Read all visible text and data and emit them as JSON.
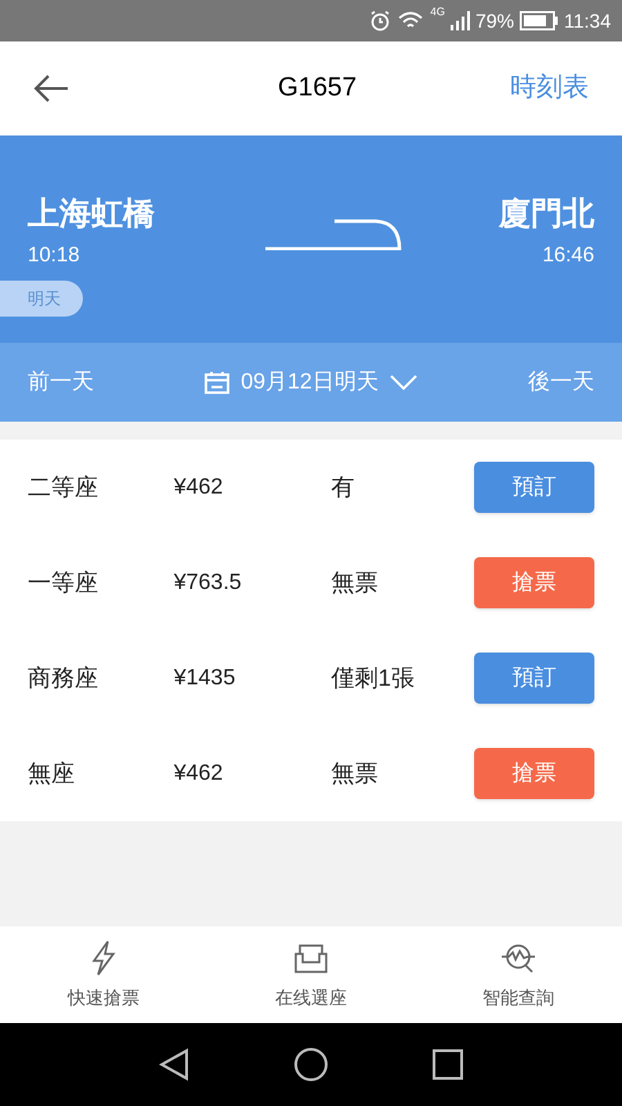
{
  "status_bar": {
    "network": "4G",
    "battery": "79%",
    "time": "11:34"
  },
  "header": {
    "title": "G1657",
    "action": "時刻表"
  },
  "train": {
    "from": "上海虹橋",
    "depart": "10:18",
    "to": "廈門北",
    "arrive": "16:46",
    "badge": "明天"
  },
  "date_bar": {
    "prev": "前一天",
    "date": "09月12日明天",
    "next": "後一天"
  },
  "seats": [
    {
      "name": "二等座",
      "price": "¥462",
      "availability": "有",
      "button": {
        "label": "預訂",
        "kind": "book"
      }
    },
    {
      "name": "一等座",
      "price": "¥763.5",
      "availability": "無票",
      "button": {
        "label": "搶票",
        "kind": "grab"
      }
    },
    {
      "name": "商務座",
      "price": "¥1435",
      "availability": "僅剩1張",
      "button": {
        "label": "預訂",
        "kind": "book"
      }
    },
    {
      "name": "無座",
      "price": "¥462",
      "availability": "無票",
      "button": {
        "label": "搶票",
        "kind": "grab"
      }
    }
  ],
  "bottom_tabs": [
    {
      "label": "快速搶票",
      "kind": "bolt"
    },
    {
      "label": "在线選座",
      "kind": "seat"
    },
    {
      "label": "智能查詢",
      "kind": "chart"
    }
  ]
}
